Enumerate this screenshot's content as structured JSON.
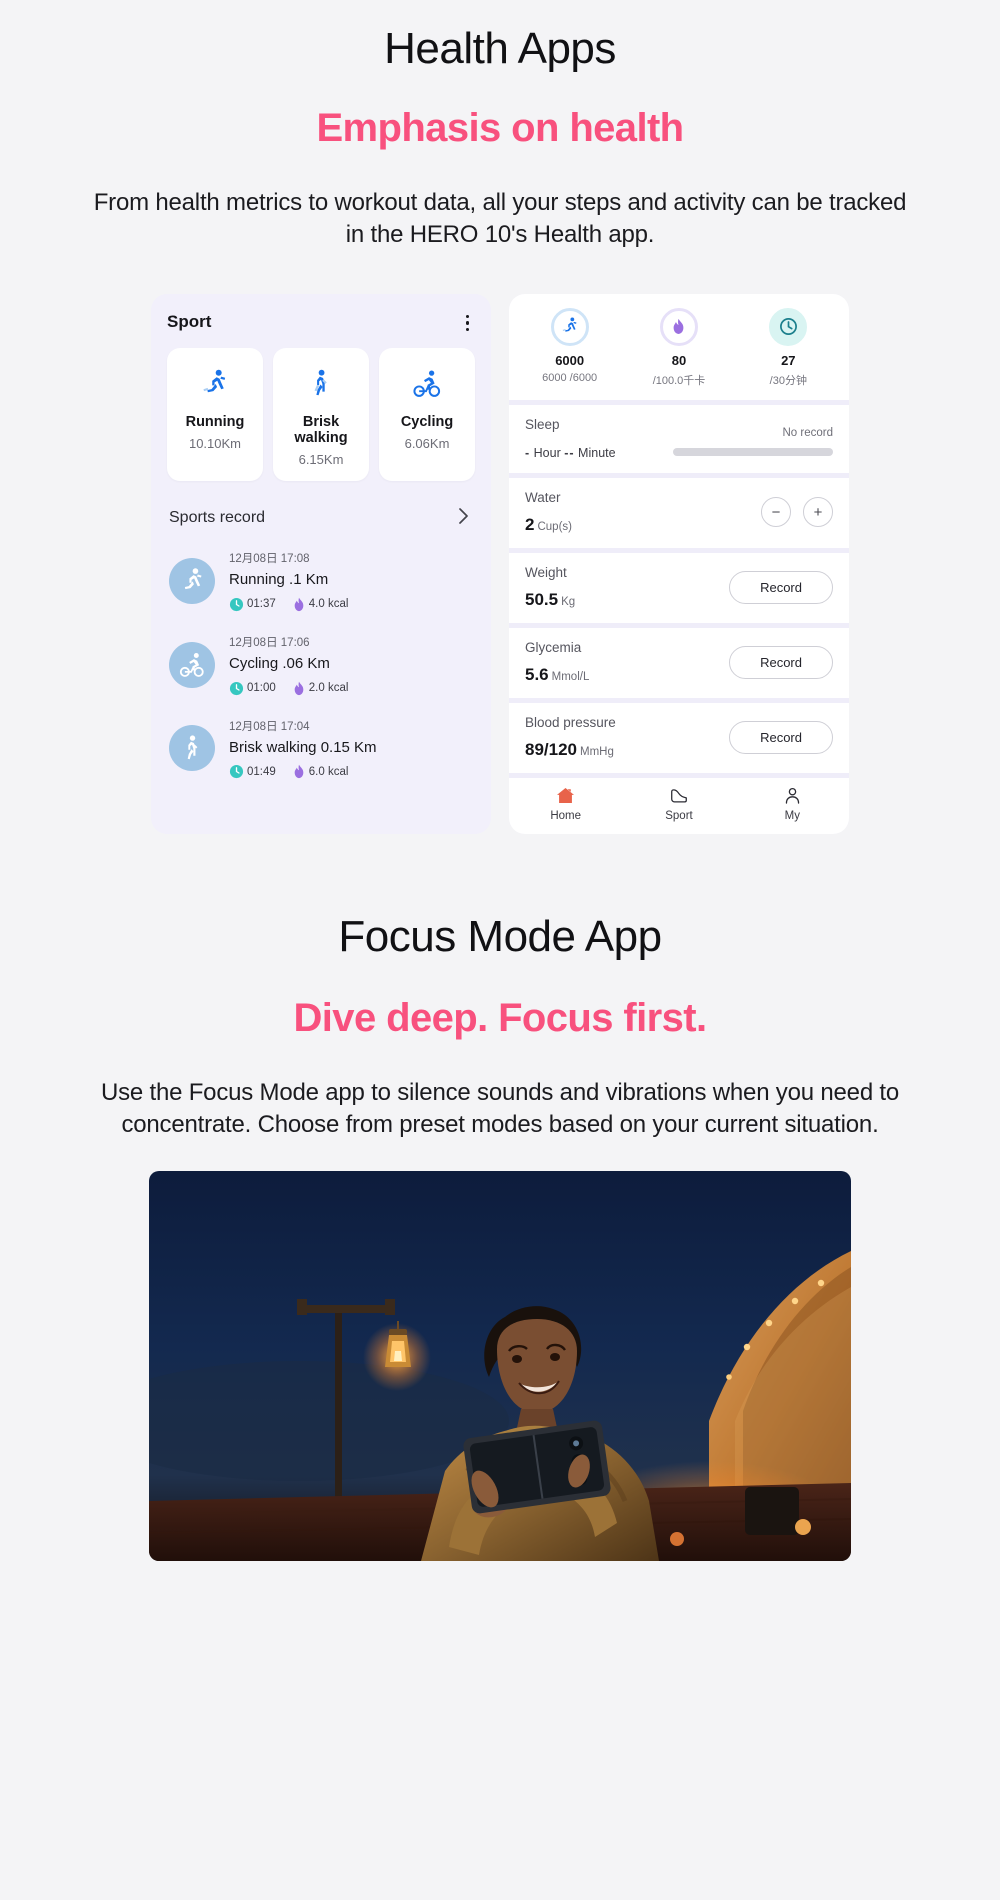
{
  "sections": [
    {
      "title": "Health Apps",
      "subtitle": "Emphasis on health",
      "body": "From health metrics to workout data, all your steps and activity can be tracked in the HERO 10's Health app."
    },
    {
      "title": "Focus Mode App",
      "subtitle": "Dive deep. Focus first.",
      "body": "Use the Focus Mode app to silence sounds and vibrations when you need to concentrate. Choose from preset modes based on your current situation."
    }
  ],
  "sport_card": {
    "title": "Sport",
    "menu_icon": "kebab-menu-icon",
    "tiles": [
      {
        "icon": "running-icon",
        "name": "Running",
        "value": "10.10Km"
      },
      {
        "icon": "walking-icon",
        "name": "Brisk walking",
        "value": "6.15Km"
      },
      {
        "icon": "cycling-icon",
        "name": "Cycling",
        "value": "6.06Km"
      }
    ],
    "records_label": "Sports record",
    "records_chevron": "chevron-right-icon",
    "records": [
      {
        "icon": "running-icon",
        "time": "12月08日 17:08",
        "title": "Running   .1 Km",
        "duration": "01:37",
        "calories": "4.0 kcal"
      },
      {
        "icon": "cycling-icon",
        "time": "12月08日 17:06",
        "title": "Cycling   .06 Km",
        "duration": "01:00",
        "calories": "2.0 kcal"
      },
      {
        "icon": "walking-icon",
        "time": "12月08日 17:04",
        "title": "Brisk walking 0.15 Km",
        "duration": "01:49",
        "calories": "6.0 kcal"
      }
    ]
  },
  "health_card": {
    "metrics": [
      {
        "icon": "running-icon",
        "value": "6000",
        "denominator": "6000 /6000"
      },
      {
        "icon": "flame-icon",
        "value": "80",
        "denominator": "/100.0千卡"
      },
      {
        "icon": "clock-icon",
        "value": "27",
        "denominator": "/30分钟"
      }
    ],
    "sleep": {
      "label": "Sleep",
      "duration_hour": "-",
      "hour_unit": "Hour",
      "duration_minute": "--",
      "minute_unit": "Minute",
      "status": "No record"
    },
    "water": {
      "label": "Water",
      "value": "2",
      "unit": "Cup(s)",
      "minus_label": "−",
      "plus_label": "+"
    },
    "weight": {
      "label": "Weight",
      "value": "50.5",
      "unit": "Kg",
      "action": "Record"
    },
    "glycemia": {
      "label": "Glycemia",
      "value": "5.6",
      "unit": "Mmol/L",
      "action": "Record"
    },
    "blood_pressure": {
      "label": "Blood pressure",
      "value": "89/120",
      "unit": "MmHg",
      "action": "Record"
    },
    "tabs": [
      {
        "icon": "home-icon",
        "label": "Home"
      },
      {
        "icon": "shoe-icon",
        "label": "Sport"
      },
      {
        "icon": "person-icon",
        "label": "My"
      }
    ]
  },
  "colors": {
    "accent_pink": "#f8517e",
    "page_bg": "#f4f4f6",
    "card_lilac": "#f2f0fb",
    "icon_blue": "#1a73e8",
    "avatar_blue": "#9fc4e4",
    "flame_purple": "#9b6fe0",
    "clock_cyan": "#36c7c0"
  },
  "photo": {
    "alt": "woman lying outside a lit tent at night holding a folding phone in landscape mode"
  }
}
